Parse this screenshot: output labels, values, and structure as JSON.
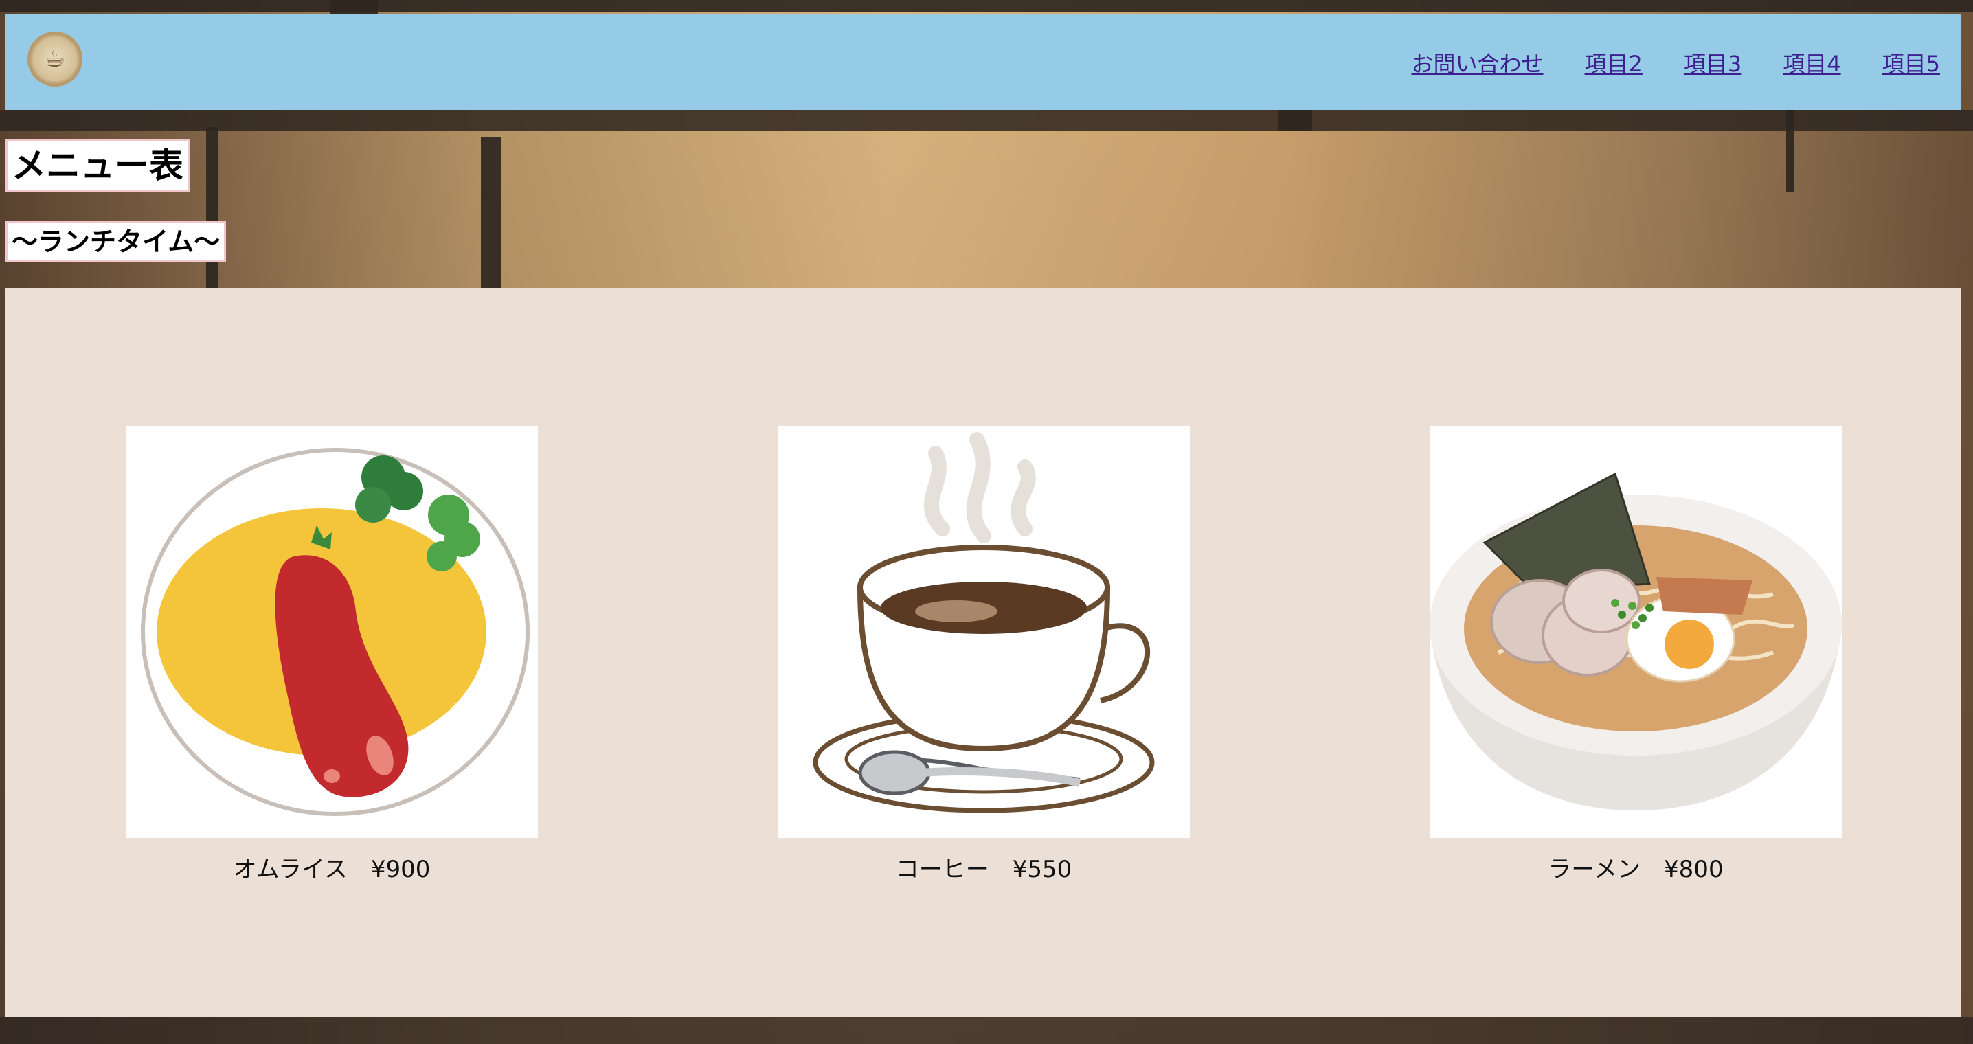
{
  "header": {
    "logo_icon": "cafe-logo-icon",
    "nav": [
      "お問い合わせ",
      "項目2",
      "項目3",
      "項目4",
      "項目5"
    ]
  },
  "page": {
    "title": "メニュー表",
    "subtitle": "〜ランチタイム〜"
  },
  "menu": {
    "items": [
      {
        "caption": "オムライス　¥900",
        "icon": "omurice-icon"
      },
      {
        "caption": "コーヒー　¥550",
        "icon": "coffee-cup-icon"
      },
      {
        "caption": "ラーメン　¥800",
        "icon": "ramen-bowl-icon"
      }
    ]
  },
  "colors": {
    "header_bg": "#96cbe8",
    "panel_bg": "#ebdfd6",
    "link": "#3d1f8f",
    "title_border": "#f0c8cc"
  }
}
